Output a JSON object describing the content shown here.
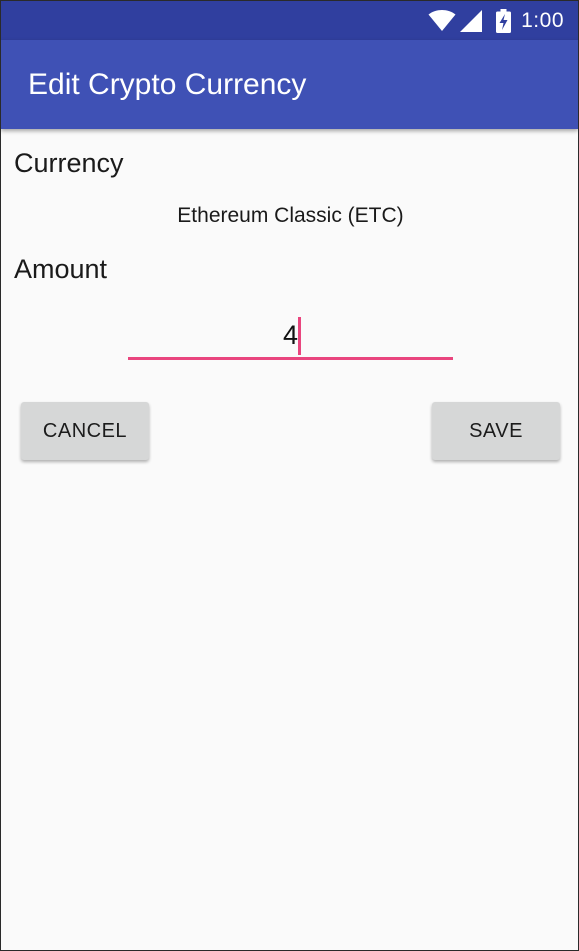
{
  "status_bar": {
    "time": "1:00",
    "icons": [
      "wifi-icon",
      "signal-icon",
      "battery-charging-icon"
    ],
    "background_color": "#303f9f"
  },
  "app_bar": {
    "title": "Edit Crypto Currency",
    "background_color": "#3f51b5"
  },
  "form": {
    "currency_label": "Currency",
    "currency_value": "Ethereum Classic (ETC)",
    "amount_label": "Amount",
    "amount_value": "4",
    "accent_color": "#e9457e"
  },
  "actions": {
    "cancel_label": "CANCEL",
    "save_label": "SAVE"
  }
}
